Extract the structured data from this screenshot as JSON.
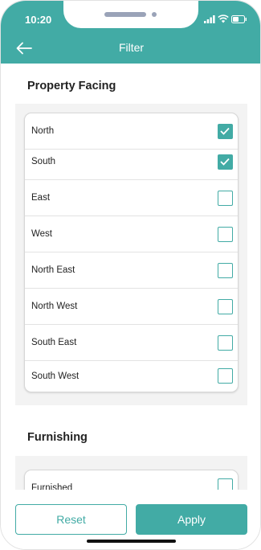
{
  "status_bar": {
    "time": "10:20"
  },
  "header": {
    "title": "Filter"
  },
  "property_facing": {
    "title": "Property Facing",
    "options": [
      {
        "label": "North",
        "checked": true
      },
      {
        "label": "South",
        "checked": true
      },
      {
        "label": "East",
        "checked": false
      },
      {
        "label": "West",
        "checked": false
      },
      {
        "label": "North East",
        "checked": false
      },
      {
        "label": "North West",
        "checked": false
      },
      {
        "label": "South East",
        "checked": false
      },
      {
        "label": "South West",
        "checked": false
      }
    ]
  },
  "furnishing": {
    "title": "Furnishing",
    "options": [
      {
        "label": "Furnished",
        "checked": false
      }
    ]
  },
  "footer": {
    "reset_label": "Reset",
    "apply_label": "Apply"
  },
  "colors": {
    "accent": "#42aba5",
    "panel": "#f3f3f3"
  },
  "icons": {
    "back": "arrow-left-icon",
    "check": "check-icon"
  }
}
